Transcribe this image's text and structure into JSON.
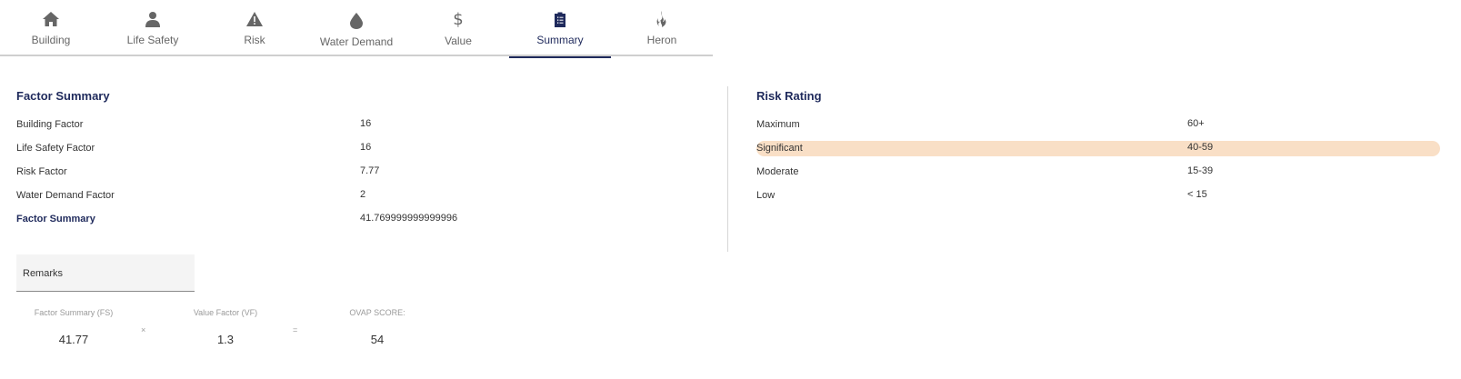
{
  "tabs": [
    {
      "label": "Building",
      "icon": "home-icon",
      "active": false
    },
    {
      "label": "Life Safety",
      "icon": "person-icon",
      "active": false
    },
    {
      "label": "Risk",
      "icon": "warning-icon",
      "active": false
    },
    {
      "label": "Water Demand",
      "icon": "droplet-icon",
      "active": false
    },
    {
      "label": "Value",
      "icon": "dollar-icon",
      "active": false
    },
    {
      "label": "Summary",
      "icon": "clipboard-icon",
      "active": true
    },
    {
      "label": "Heron",
      "icon": "flame-icon",
      "active": false
    }
  ],
  "factor_summary": {
    "title": "Factor Summary",
    "rows": [
      {
        "label": "Building Factor",
        "value": "16"
      },
      {
        "label": "Life Safety Factor",
        "value": "16"
      },
      {
        "label": "Risk Factor",
        "value": "7.77"
      },
      {
        "label": "Water Demand Factor",
        "value": "2"
      },
      {
        "label": "Factor Summary",
        "value": "41.769999999999996"
      }
    ]
  },
  "risk_rating": {
    "title": "Risk Rating",
    "rows": [
      {
        "label": "Maximum",
        "value": "60+"
      },
      {
        "label": "Significant",
        "value": "40-59",
        "highlighted": true
      },
      {
        "label": "Moderate",
        "value": "15-39"
      },
      {
        "label": "Low",
        "value": "< 15"
      }
    ],
    "highlight_color": "#f9dfc6"
  },
  "remarks": {
    "label": "Remarks"
  },
  "score": {
    "fs_label": "Factor Summary (FS)",
    "fs_value": "41.77",
    "times": "×",
    "vf_label": "Value Factor (VF)",
    "vf_value": "1.3",
    "equals": "=",
    "ovap_label": "OVAP SCORE:",
    "ovap_value": "54"
  },
  "colors": {
    "accent": "#1f2a5c",
    "muted": "#666666"
  }
}
